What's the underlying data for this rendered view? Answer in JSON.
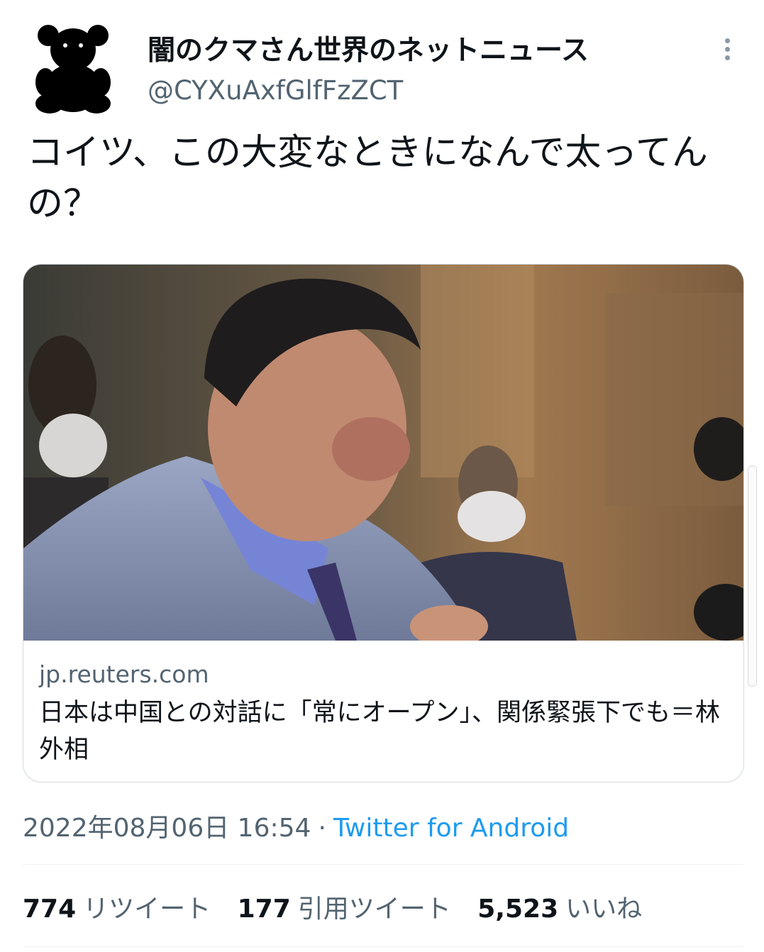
{
  "author": {
    "display_name": "闇のクマさん世界のネットニュース",
    "handle": "@CYXuAxfGlfFzZCT",
    "avatar_icon": "bear-silhouette-icon"
  },
  "tweet": {
    "text": "コイツ、この大変なときになんで太ってんの？"
  },
  "card": {
    "domain": "jp.reuters.com",
    "title": "日本は中国との対話に「常にオープン」、関係緊張下でも＝林外相"
  },
  "meta": {
    "datetime": "2022年08月06日 16:54",
    "separator": "·",
    "source": "Twitter for Android"
  },
  "stats": {
    "retweets": {
      "count": "774",
      "label": "リツイート"
    },
    "quotes": {
      "count": "177",
      "label": "引用ツイート"
    },
    "likes": {
      "count": "5,523",
      "label": "いいね"
    }
  },
  "colors": {
    "text": "#0f1419",
    "secondary": "#536471",
    "link": "#1d9bf0",
    "border": "#cfd9de"
  }
}
